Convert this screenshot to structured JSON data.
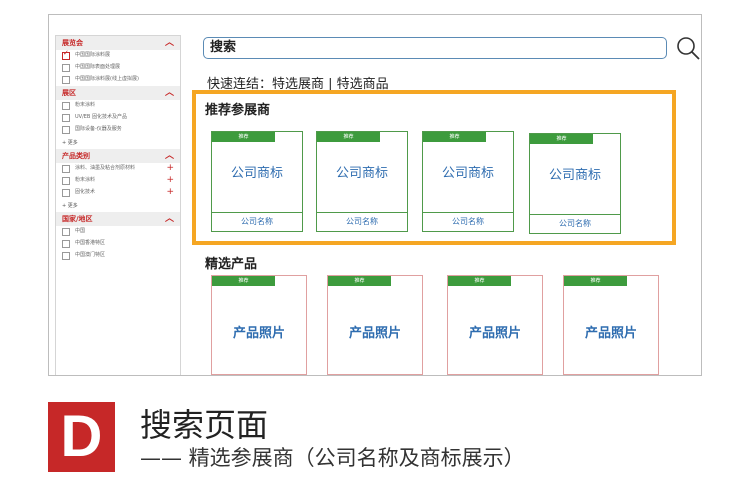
{
  "sidebar": {
    "sections": [
      {
        "title": "展览会",
        "items": [
          {
            "label": "中国国际涂料展",
            "checked": true,
            "plus": false
          },
          {
            "label": "中国国际表面处理展",
            "checked": false,
            "plus": false
          },
          {
            "label": "中国国际涂料展(线上虚拟展)",
            "checked": false,
            "plus": false
          }
        ]
      },
      {
        "title": "展区",
        "items": [
          {
            "label": "粉末涂料",
            "checked": false,
            "plus": false
          },
          {
            "label": "UV/EB 固化技术及产品",
            "checked": false,
            "plus": false
          },
          {
            "label": "国际设备-仪器及服务",
            "checked": false,
            "plus": false
          }
        ],
        "more": "+ 更多"
      },
      {
        "title": "产品类别",
        "items": [
          {
            "label": "涂料、油墨及粘合剂原材料",
            "checked": false,
            "plus": true
          },
          {
            "label": "粉末涂料",
            "checked": false,
            "plus": true
          },
          {
            "label": "固化技术",
            "checked": false,
            "plus": true
          }
        ],
        "more": "+ 更多"
      },
      {
        "title": "国家/地区",
        "items": [
          {
            "label": "中国",
            "checked": false,
            "plus": false
          },
          {
            "label": "中国香港特区",
            "checked": false,
            "plus": false
          },
          {
            "label": "中国澳门特区",
            "checked": false,
            "plus": false
          }
        ]
      }
    ]
  },
  "search": {
    "value": "搜索"
  },
  "quick_links": "快速连结：特选展商 | 特选商品",
  "recommended": {
    "title": "推荐参展商",
    "cards": [
      {
        "badge": "推荐",
        "logo": "公司商标",
        "name": "公司名称"
      },
      {
        "badge": "推荐",
        "logo": "公司商标",
        "name": "公司名称"
      },
      {
        "badge": "推荐",
        "logo": "公司商标",
        "name": "公司名称"
      },
      {
        "badge": "推荐",
        "logo": "公司商标",
        "name": "公司名称"
      }
    ]
  },
  "featured": {
    "title": "精选产品",
    "cards": [
      {
        "badge": "推荐",
        "photo": "产品照片"
      },
      {
        "badge": "推荐",
        "photo": "产品照片"
      },
      {
        "badge": "推荐",
        "photo": "产品照片"
      },
      {
        "badge": "推荐",
        "photo": "产品照片"
      }
    ]
  },
  "caption": {
    "letter": "D",
    "title": "搜索页面",
    "subtitle": "—— 精选参展商（公司名称及商标展示）"
  },
  "colors": {
    "accent_red": "#c62828",
    "highlight_orange": "#f5a623",
    "badge_green": "#3d9b3d",
    "link_blue": "#2f6db0"
  }
}
